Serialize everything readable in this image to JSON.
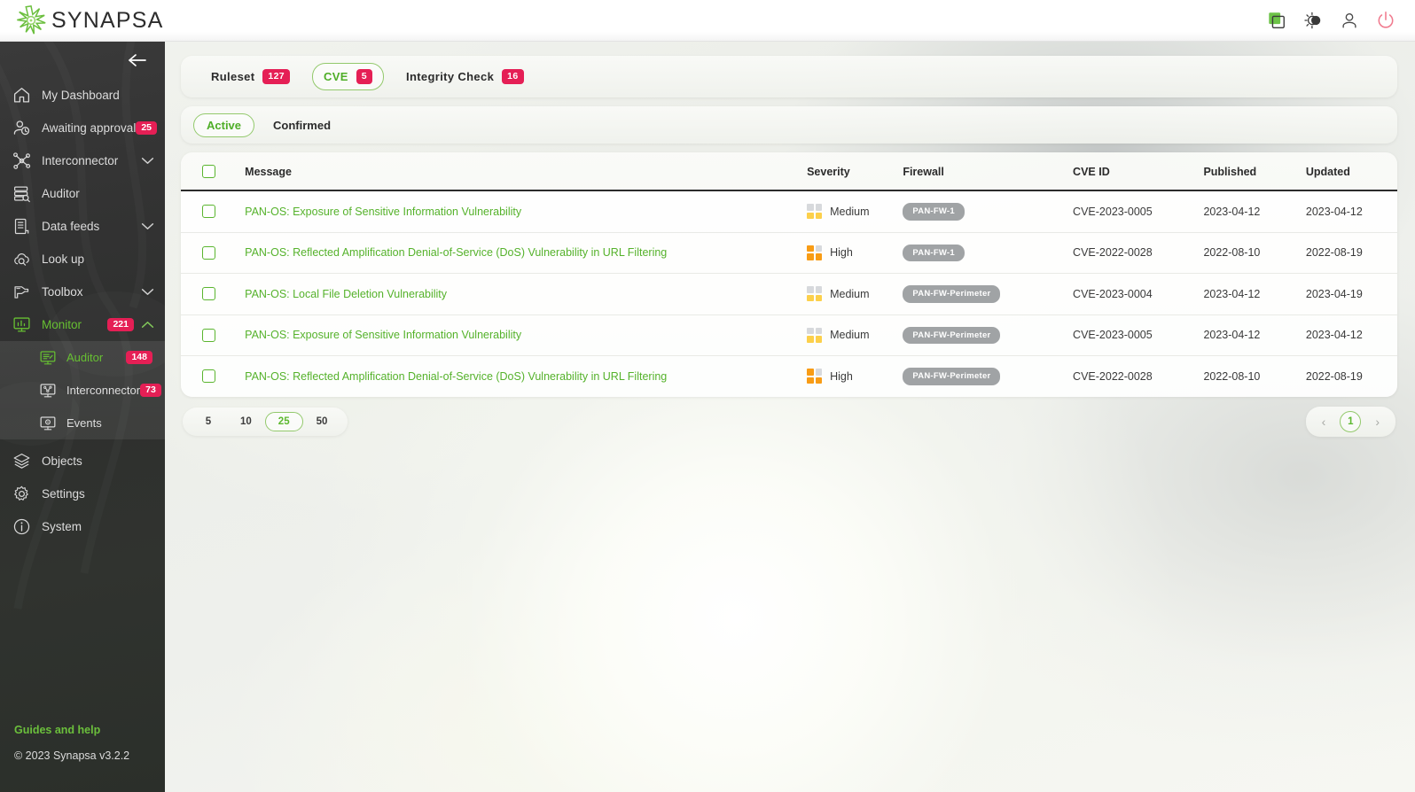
{
  "app": {
    "brand": "SYNAPSA",
    "logo_icon": "synapsa-star-icon"
  },
  "topbar": {
    "icons": [
      {
        "name": "duplicate-window-icon",
        "color": "#6dc348"
      },
      {
        "name": "theme-toggle-icon",
        "color": "#3a3a3a"
      },
      {
        "name": "user-account-icon",
        "color": "#4a4a4a"
      },
      {
        "name": "power-logout-icon",
        "color": "#f07a8e"
      }
    ]
  },
  "sidebar": {
    "collapse_icon": "arrow-left-icon",
    "items": [
      {
        "label": "My Dashboard",
        "icon": "home-icon",
        "badge": null,
        "chevron": null,
        "active": false
      },
      {
        "label": "Awaiting approval",
        "icon": "user-clock-icon",
        "badge": "25",
        "chevron": null,
        "active": false
      },
      {
        "label": "Interconnector",
        "icon": "network-nodes-icon",
        "badge": null,
        "chevron": "chevron-down-icon",
        "active": false
      },
      {
        "label": "Auditor",
        "icon": "server-search-icon",
        "badge": null,
        "chevron": null,
        "active": false
      },
      {
        "label": "Data feeds",
        "icon": "data-feed-icon",
        "badge": null,
        "chevron": "chevron-down-icon",
        "active": false
      },
      {
        "label": "Look up",
        "icon": "cloud-search-icon",
        "badge": null,
        "chevron": null,
        "active": false
      },
      {
        "label": "Toolbox",
        "icon": "drill-icon",
        "badge": null,
        "chevron": "chevron-down-icon",
        "active": false
      },
      {
        "label": "Monitor",
        "icon": "monitor-chart-icon",
        "badge": "221",
        "chevron": "chevron-up-icon",
        "active": true
      }
    ],
    "submenu": [
      {
        "label": "Auditor",
        "icon": "monitor-auditor-icon",
        "badge": "148",
        "active": true
      },
      {
        "label": "Interconnector",
        "icon": "monitor-interconnector-icon",
        "badge": "73",
        "active": false
      },
      {
        "label": "Events",
        "icon": "monitor-events-icon",
        "badge": null,
        "active": false
      }
    ],
    "items_bottom": [
      {
        "label": "Objects",
        "icon": "layers-icon",
        "badge": null,
        "chevron": null,
        "active": false
      },
      {
        "label": "Settings",
        "icon": "gear-icon",
        "badge": null,
        "chevron": null,
        "active": false
      },
      {
        "label": "System",
        "icon": "info-circle-icon",
        "badge": null,
        "chevron": null,
        "active": false
      }
    ],
    "footer": {
      "guides_link": "Guides and help",
      "copyright": "© 2023 Synapsa v3.2.2"
    }
  },
  "tabs": [
    {
      "label": "Ruleset",
      "badge": "127",
      "selected": false
    },
    {
      "label": "CVE",
      "badge": "5",
      "selected": true
    },
    {
      "label": "Integrity Check",
      "badge": "16",
      "selected": false
    }
  ],
  "filters": [
    {
      "label": "Active",
      "selected": true
    },
    {
      "label": "Confirmed",
      "selected": false
    }
  ],
  "table": {
    "columns": [
      "",
      "Message",
      "Severity",
      "Firewall",
      "CVE ID",
      "Published",
      "Updated"
    ],
    "rows": [
      {
        "message": "PAN-OS: Exposure of Sensitive Information Vulnerability",
        "severity": "Medium",
        "severity_cells": [
          "#d7d9dc",
          "#d7d9dc",
          "#fcd04b",
          "#fcd04b"
        ],
        "firewall": "PAN-FW-1",
        "cve_id": "CVE-2023-0005",
        "published": "2023-04-12",
        "updated": "2023-04-12"
      },
      {
        "message": "PAN-OS: Reflected Amplification Denial-of-Service (DoS) Vulnerability in URL Filtering",
        "severity": "High",
        "severity_cells": [
          "#f89c15",
          "#d7d9dc",
          "#f89c15",
          "#f89c15"
        ],
        "firewall": "PAN-FW-1",
        "cve_id": "CVE-2022-0028",
        "published": "2022-08-10",
        "updated": "2022-08-19"
      },
      {
        "message": "PAN-OS: Local File Deletion Vulnerability",
        "severity": "Medium",
        "severity_cells": [
          "#d7d9dc",
          "#d7d9dc",
          "#fcd04b",
          "#fcd04b"
        ],
        "firewall": "PAN-FW-Perimeter",
        "cve_id": "CVE-2023-0004",
        "published": "2023-04-12",
        "updated": "2023-04-19"
      },
      {
        "message": "PAN-OS: Exposure of Sensitive Information Vulnerability",
        "severity": "Medium",
        "severity_cells": [
          "#d7d9dc",
          "#d7d9dc",
          "#fcd04b",
          "#fcd04b"
        ],
        "firewall": "PAN-FW-Perimeter",
        "cve_id": "CVE-2023-0005",
        "published": "2023-04-12",
        "updated": "2023-04-12"
      },
      {
        "message": "PAN-OS: Reflected Amplification Denial-of-Service (DoS) Vulnerability in URL Filtering",
        "severity": "High",
        "severity_cells": [
          "#f89c15",
          "#d7d9dc",
          "#f89c15",
          "#f89c15"
        ],
        "firewall": "PAN-FW-Perimeter",
        "cve_id": "CVE-2022-0028",
        "published": "2022-08-10",
        "updated": "2022-08-19"
      }
    ]
  },
  "pagination": {
    "page_sizes": [
      "5",
      "10",
      "25",
      "50"
    ],
    "selected_page_size": "25",
    "prev_icon": "‹",
    "next_icon": "›",
    "current_page": "1"
  },
  "colors": {
    "accent_green": "#5cb82f",
    "badge_red": "#e51f55",
    "severity_medium": "#fcd04b",
    "severity_high": "#f89c15",
    "firewall_badge": "#a0a3a5"
  }
}
